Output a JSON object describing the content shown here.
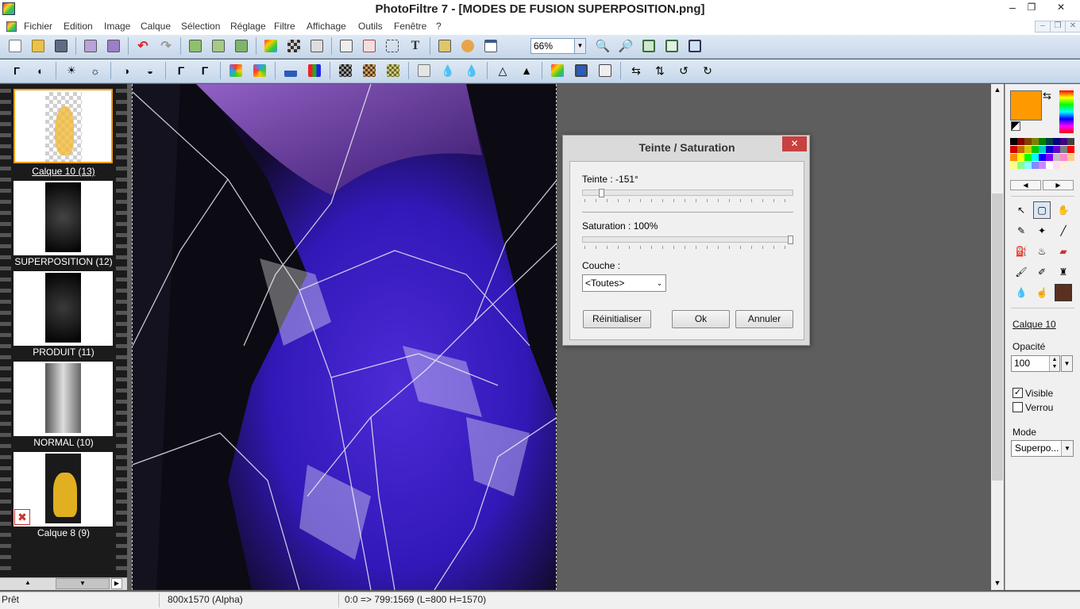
{
  "window": {
    "title": "PhotoFiltre 7 - [MODES DE FUSION SUPERPOSITION.png]",
    "minimize": "‒",
    "maximize": "❐",
    "close": "✕"
  },
  "menu": [
    "Fichier",
    "Edition",
    "Image",
    "Calque",
    "Sélection",
    "Réglage",
    "Filtre",
    "Affichage",
    "Outils",
    "Fenêtre",
    "?"
  ],
  "toolbar": {
    "zoom": "66%"
  },
  "layers": [
    {
      "label": "Calque 10 (13)",
      "selected": true
    },
    {
      "label": "SUPERPOSITION (12)"
    },
    {
      "label": "PRODUIT (11)"
    },
    {
      "label": "NORMAL (10)"
    },
    {
      "label": "Calque 8 (9)"
    }
  ],
  "dialog": {
    "title": "Teinte / Saturation",
    "close": "✕",
    "hue_label": "Teinte : -151°",
    "hue_value": -151,
    "saturation_label": "Saturation : 100%",
    "saturation_value": 100,
    "layer_label": "Couche :",
    "layer_select": "<Toutes>",
    "reset_button": "Réinitialiser",
    "ok_button": "Ok",
    "cancel_button": "Annuler"
  },
  "right_panel": {
    "foreground_color": "#ff9900",
    "background_color": "#ffffff",
    "layer_name": "Calque 10",
    "opacity_label": "Opacité",
    "opacity_value": "100",
    "visible_label": "Visible",
    "visible_checked": true,
    "lock_label": "Verrou",
    "lock_checked": false,
    "mode_label": "Mode",
    "mode_value": "Superpo..."
  },
  "status": {
    "ready": "Prêt",
    "size": "800x1570 (Alpha)",
    "coords": "0:0 => 799:1569 (L=800  H=1570)"
  }
}
